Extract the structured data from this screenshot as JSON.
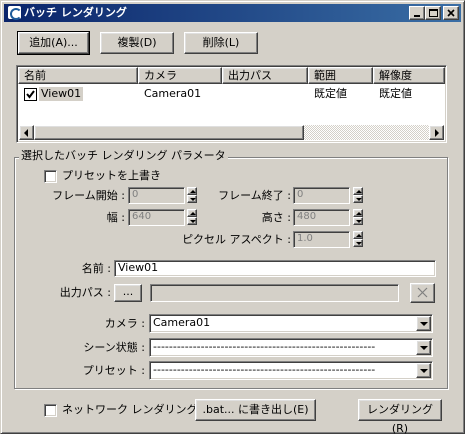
{
  "window": {
    "title": "バッチ レンダリング"
  },
  "toolbar": {
    "add_label": "追加(A)...",
    "duplicate_label": "複製(D)",
    "delete_label": "削除(L)"
  },
  "table": {
    "columns": [
      "名前",
      "カメラ",
      "出力パス",
      "範囲",
      "解像度"
    ],
    "rows": [
      {
        "checked": true,
        "name": "View01",
        "camera": "Camera01",
        "output_path": "",
        "range": "既定値",
        "resolution": "既定値"
      }
    ]
  },
  "params": {
    "group_title": "選択したバッチ レンダリング パラメータ",
    "override_preset_label": "プリセットを上書き",
    "frame_start_label": "フレーム開始 :",
    "frame_start_value": "0",
    "frame_end_label": "フレーム終了 :",
    "frame_end_value": "0",
    "width_label": "幅 :",
    "width_value": "640",
    "height_label": "高さ :",
    "height_value": "480",
    "pixel_aspect_label": "ピクセル アスペクト :",
    "pixel_aspect_value": "1.0",
    "name_label": "名前 :",
    "name_value": "View01",
    "output_path_label": "出力パス :",
    "output_path_browse": "...",
    "output_path_value": "",
    "camera_label": "カメラ :",
    "camera_value": "Camera01",
    "scene_state_label": "シーン状態 :",
    "scene_state_value": "--------------------------------------------------------",
    "preset_label": "プリセット :",
    "preset_value": "--------------------------------------------------------"
  },
  "footer": {
    "network_label": "ネットワーク レンダリング",
    "export_bat_label": ".bat... に書き出し(E)",
    "render_label": "レンダリング(R)"
  }
}
